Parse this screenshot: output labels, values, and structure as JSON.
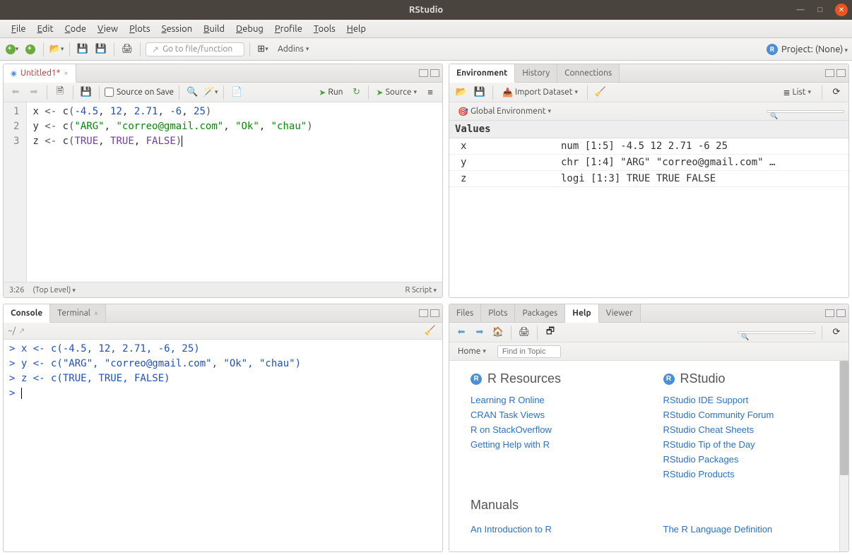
{
  "window": {
    "title": "RStudio"
  },
  "menubar": [
    "File",
    "Edit",
    "Code",
    "View",
    "Plots",
    "Session",
    "Build",
    "Debug",
    "Profile",
    "Tools",
    "Help"
  ],
  "toolbar": {
    "goto_placeholder": "Go to file/function",
    "addins": "Addins",
    "project": "Project: (None)"
  },
  "source": {
    "tab": "Untitled1*",
    "source_on_save": "Source on Save",
    "run": "Run",
    "source_btn": "Source",
    "lines": [
      {
        "n": "1",
        "tokens": [
          {
            "t": "x ",
            "c": ""
          },
          {
            "t": "<-",
            "c": "op"
          },
          {
            "t": " c",
            "c": ""
          },
          {
            "t": "(",
            "c": "op"
          },
          {
            "t": "-4.5",
            "c": "num"
          },
          {
            "t": ", ",
            "c": ""
          },
          {
            "t": "12",
            "c": "num"
          },
          {
            "t": ", ",
            "c": ""
          },
          {
            "t": "2.71",
            "c": "num"
          },
          {
            "t": ", ",
            "c": ""
          },
          {
            "t": "-6",
            "c": "num"
          },
          {
            "t": ", ",
            "c": ""
          },
          {
            "t": "25",
            "c": "num"
          },
          {
            "t": ")",
            "c": "op"
          }
        ]
      },
      {
        "n": "2",
        "tokens": [
          {
            "t": "y ",
            "c": ""
          },
          {
            "t": "<-",
            "c": "op"
          },
          {
            "t": " c",
            "c": ""
          },
          {
            "t": "(",
            "c": "op"
          },
          {
            "t": "\"ARG\"",
            "c": "str"
          },
          {
            "t": ", ",
            "c": ""
          },
          {
            "t": "\"correo@gmail.com\"",
            "c": "str"
          },
          {
            "t": ", ",
            "c": ""
          },
          {
            "t": "\"Ok\"",
            "c": "str"
          },
          {
            "t": ", ",
            "c": ""
          },
          {
            "t": "\"chau\"",
            "c": "str"
          },
          {
            "t": ")",
            "c": "op"
          }
        ]
      },
      {
        "n": "3",
        "tokens": [
          {
            "t": "z ",
            "c": ""
          },
          {
            "t": "<-",
            "c": "op"
          },
          {
            "t": " c",
            "c": ""
          },
          {
            "t": "(",
            "c": "op"
          },
          {
            "t": "TRUE",
            "c": "bool"
          },
          {
            "t": ", ",
            "c": ""
          },
          {
            "t": "TRUE",
            "c": "bool"
          },
          {
            "t": ", ",
            "c": ""
          },
          {
            "t": "FALSE",
            "c": "bool"
          },
          {
            "t": ")",
            "c": "op"
          }
        ]
      }
    ],
    "status_pos": "3:26",
    "status_scope": "(Top Level)",
    "status_type": "R Script"
  },
  "console": {
    "tab1": "Console",
    "tab2": "Terminal",
    "prompt_path": "~/",
    "lines": [
      "> x <- c(-4.5, 12, 2.71, -6, 25)",
      "> y <- c(\"ARG\", \"correo@gmail.com\", \"Ok\", \"chau\")",
      "> z <- c(TRUE, TRUE, FALSE)",
      "> "
    ]
  },
  "env": {
    "tabs": [
      "Environment",
      "History",
      "Connections"
    ],
    "import": "Import Dataset",
    "list": "List",
    "scope": "Global Environment",
    "section": "Values",
    "rows": [
      {
        "name": "x",
        "value": "num [1:5] -4.5 12 2.71 -6 25"
      },
      {
        "name": "y",
        "value": "chr [1:4] \"ARG\" \"correo@gmail.com\" …"
      },
      {
        "name": "z",
        "value": "logi [1:3] TRUE TRUE FALSE"
      }
    ]
  },
  "help": {
    "tabs": [
      "Files",
      "Plots",
      "Packages",
      "Help",
      "Viewer"
    ],
    "home": "Home",
    "find_placeholder": "Find in Topic",
    "col1_title": "R Resources",
    "col2_title": "RStudio",
    "col1_links": [
      "Learning R Online",
      "CRAN Task Views",
      "R on StackOverflow",
      "Getting Help with R"
    ],
    "col2_links": [
      "RStudio IDE Support",
      "RStudio Community Forum",
      "RStudio Cheat Sheets",
      "RStudio Tip of the Day",
      "RStudio Packages",
      "RStudio Products"
    ],
    "manuals_title": "Manuals",
    "manual_col1": [
      "An Introduction to R"
    ],
    "manual_col2": [
      "The R Language Definition"
    ]
  }
}
